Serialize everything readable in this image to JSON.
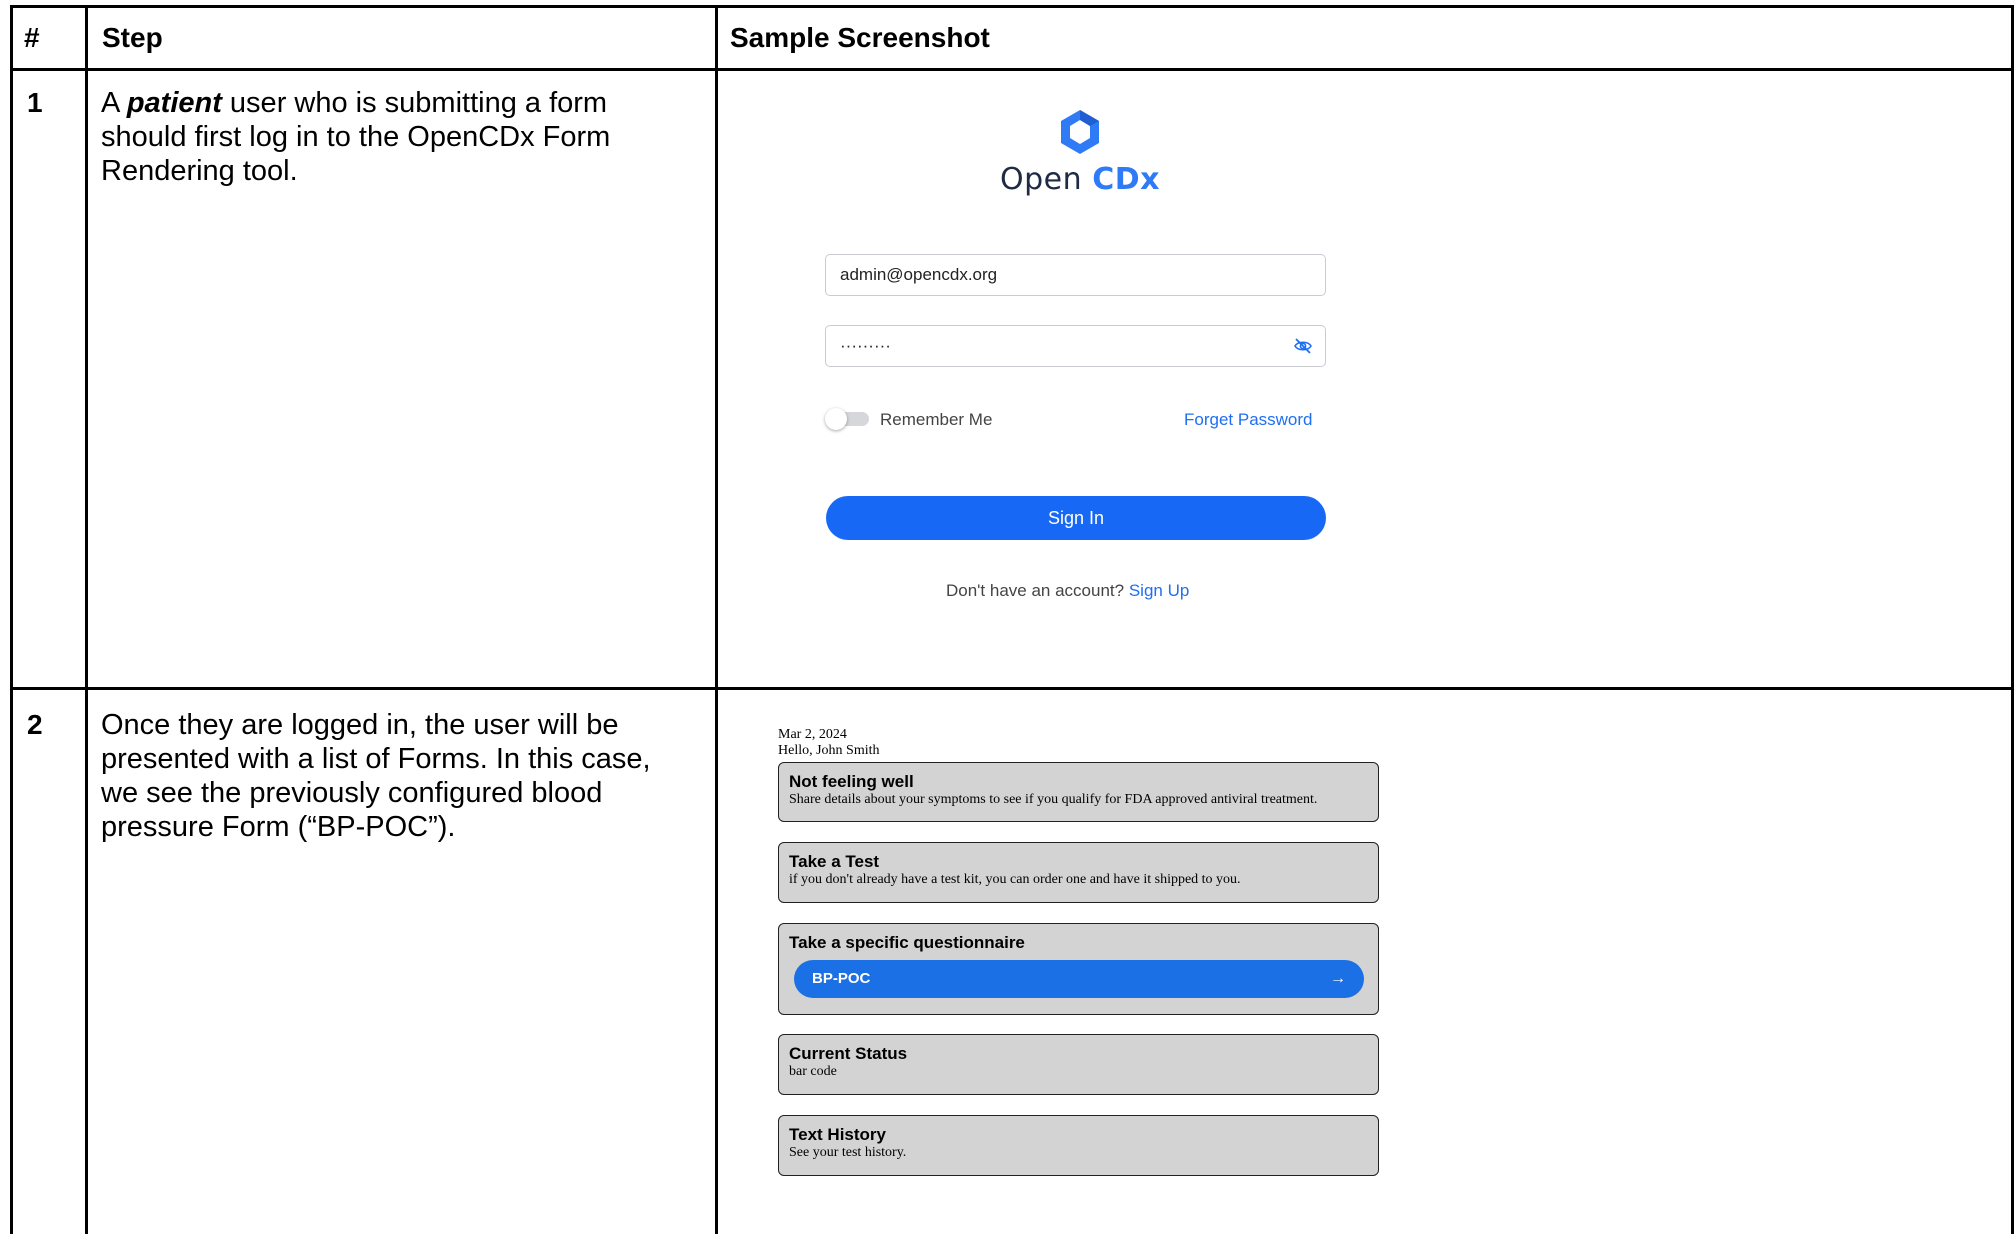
{
  "table": {
    "headers": {
      "num": "#",
      "step": "Step",
      "screenshot": "Sample Screenshot"
    },
    "rows": [
      {
        "num": "1",
        "step_prefix": "A ",
        "step_emphasis": "patient",
        "step_suffix": " user who is submitting a form should first log in to the OpenCDx Form Rendering tool."
      },
      {
        "num": "2",
        "step_text": "Once they are logged in, the user will be presented with a list of Forms. In this case, we see the previously configured blood pressure Form (“BP-POC”)."
      }
    ]
  },
  "login": {
    "logo_open": "Open",
    "logo_cdx": "CDx",
    "email_value": "admin@opencdx.org",
    "password_value": "·········",
    "remember_label": "Remember Me",
    "forgot_label": "Forget Password",
    "signin_label": "Sign In",
    "no_account_text": "Don't have an account?",
    "signup_label": "Sign Up",
    "colors": {
      "brand": "#1769f5",
      "link": "#1f6ff2"
    }
  },
  "forms_screen": {
    "date": "Mar 2, 2024",
    "greeting": "Hello, John Smith",
    "cards": [
      {
        "title": "Not feeling well",
        "desc": "Share details about your symptoms to see if you qualify for FDA approved antiviral treatment."
      },
      {
        "title": "Take a Test",
        "desc": "if you don't already have a test kit, you can order one and have it shipped to you."
      },
      {
        "title": "Take a specific questionnaire",
        "button": "BP-POC"
      },
      {
        "title": "Current Status",
        "desc": "bar code"
      },
      {
        "title": "Text History",
        "desc": "See your test history."
      }
    ],
    "arrow_icon": "arrow-right-icon"
  }
}
